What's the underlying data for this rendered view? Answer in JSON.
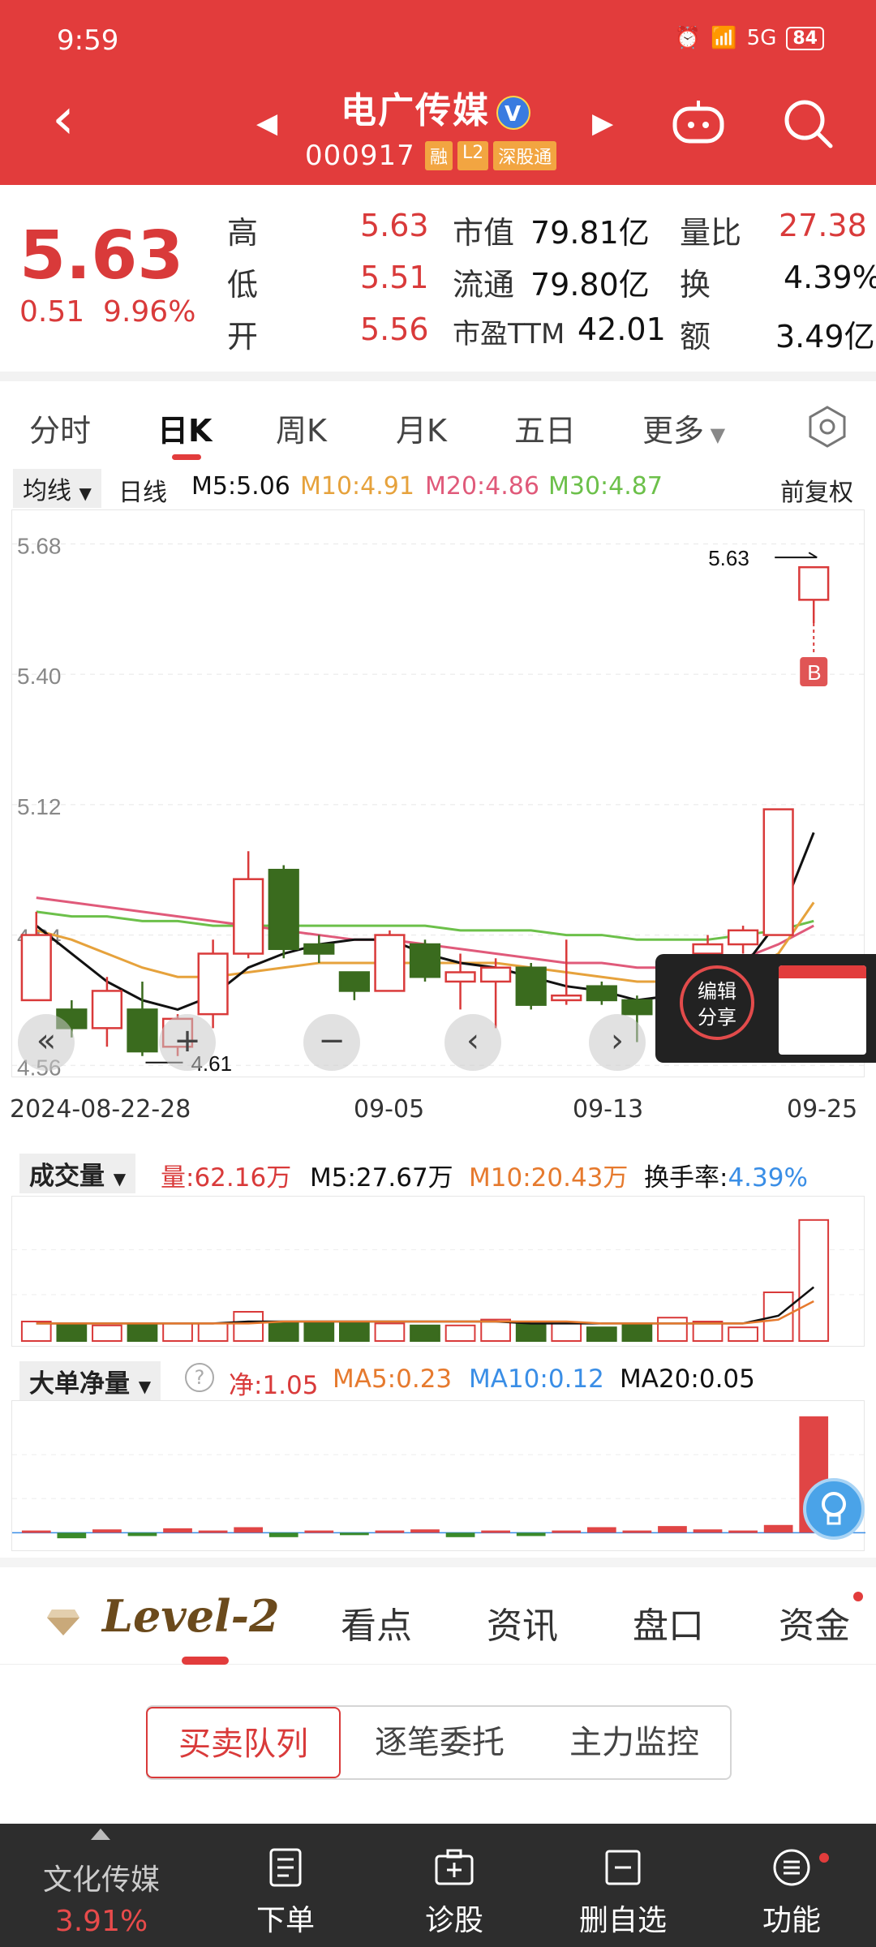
{
  "status": {
    "time": "9:59",
    "signal": "5G",
    "battery": "84"
  },
  "header": {
    "name": "电广传媒",
    "verify": "V",
    "code": "000917",
    "tags": [
      "融",
      "L2",
      "深股通"
    ]
  },
  "quote": {
    "price": "5.63",
    "change": "0.51",
    "change_pct": "9.96%",
    "rows": [
      {
        "l1": "高",
        "v1": "5.63",
        "l2": "市值",
        "v2": "79.81亿",
        "l3": "量比",
        "v3": "27.38"
      },
      {
        "l1": "低",
        "v1": "5.51",
        "l2": "流通",
        "v2": "79.80亿",
        "l3": "换",
        "v3": "4.39%"
      },
      {
        "l1": "开",
        "v1": "5.56",
        "l2": "市盈TTM",
        "v2": "42.01",
        "l3": "额",
        "v3": "3.49亿"
      }
    ]
  },
  "period_tabs": [
    "分时",
    "日K",
    "周K",
    "月K",
    "五日",
    "更多"
  ],
  "ma": {
    "dropdown": "均线",
    "period": "日线",
    "m5": "M5:5.06",
    "m10": "M10:4.91",
    "m20": "M20:4.86",
    "m30": "M30:4.87",
    "adjust": "前复权",
    "colors": {
      "m5": "#111111",
      "m10": "#e6a23c",
      "m20": "#e05a7a",
      "m30": "#6cc04a"
    }
  },
  "chart_data": [
    {
      "type": "candlestick",
      "y_ticks": [
        "5.68",
        "5.40",
        "5.12",
        "4.84",
        "4.56"
      ],
      "ylim": [
        4.55,
        5.7
      ],
      "high_label": "5.63",
      "low_label": "4.61",
      "x_ticks": [
        "2024-08-22",
        "-28",
        "09-05",
        "09-13",
        "09-25"
      ],
      "candles": [
        {
          "o": 4.7,
          "c": 4.84,
          "h": 4.89,
          "l": 4.7
        },
        {
          "o": 4.68,
          "c": 4.64,
          "h": 4.7,
          "l": 4.62
        },
        {
          "o": 4.64,
          "c": 4.72,
          "h": 4.75,
          "l": 4.6
        },
        {
          "o": 4.68,
          "c": 4.59,
          "h": 4.74,
          "l": 4.58
        },
        {
          "o": 4.6,
          "c": 4.66,
          "h": 4.67,
          "l": 4.58
        },
        {
          "o": 4.67,
          "c": 4.8,
          "h": 4.83,
          "l": 4.64
        },
        {
          "o": 4.8,
          "c": 4.96,
          "h": 5.02,
          "l": 4.79
        },
        {
          "o": 4.98,
          "c": 4.81,
          "h": 4.99,
          "l": 4.79
        },
        {
          "o": 4.82,
          "c": 4.8,
          "h": 4.84,
          "l": 4.78
        },
        {
          "o": 4.76,
          "c": 4.72,
          "h": 4.76,
          "l": 4.7
        },
        {
          "o": 4.72,
          "c": 4.84,
          "h": 4.85,
          "l": 4.72
        },
        {
          "o": 4.82,
          "c": 4.75,
          "h": 4.83,
          "l": 4.74
        },
        {
          "o": 4.74,
          "c": 4.76,
          "h": 4.8,
          "l": 4.68
        },
        {
          "o": 4.74,
          "c": 4.77,
          "h": 4.79,
          "l": 4.64
        },
        {
          "o": 4.77,
          "c": 4.69,
          "h": 4.78,
          "l": 4.68
        },
        {
          "o": 4.7,
          "c": 4.71,
          "h": 4.83,
          "l": 4.69
        },
        {
          "o": 4.73,
          "c": 4.7,
          "h": 4.74,
          "l": 4.69
        },
        {
          "o": 4.7,
          "c": 4.67,
          "h": 4.71,
          "l": 4.61
        },
        {
          "o": 4.72,
          "c": 4.77,
          "h": 4.78,
          "l": 4.7
        },
        {
          "o": 4.8,
          "c": 4.82,
          "h": 4.84,
          "l": 4.79
        },
        {
          "o": 4.82,
          "c": 4.85,
          "h": 4.86,
          "l": 4.8
        },
        {
          "o": 4.84,
          "c": 5.11,
          "h": 5.11,
          "l": 4.84
        },
        {
          "o": 5.56,
          "c": 5.63,
          "h": 5.63,
          "l": 5.51
        }
      ],
      "ma5": [
        4.86,
        4.8,
        4.74,
        4.7,
        4.68,
        4.71,
        4.77,
        4.8,
        4.82,
        4.83,
        4.83,
        4.8,
        4.78,
        4.77,
        4.75,
        4.73,
        4.72,
        4.7,
        4.71,
        4.74,
        4.77,
        4.87,
        5.06
      ],
      "ma10": [
        4.85,
        4.83,
        4.8,
        4.77,
        4.75,
        4.75,
        4.76,
        4.77,
        4.78,
        4.78,
        4.78,
        4.78,
        4.78,
        4.78,
        4.77,
        4.76,
        4.75,
        4.74,
        4.74,
        4.74,
        4.76,
        4.8,
        4.91
      ],
      "ma20": [
        4.92,
        4.91,
        4.9,
        4.89,
        4.88,
        4.87,
        4.86,
        4.85,
        4.84,
        4.83,
        4.83,
        4.82,
        4.81,
        4.8,
        4.79,
        4.78,
        4.78,
        4.77,
        4.77,
        4.78,
        4.79,
        4.82,
        4.86
      ],
      "ma30": [
        4.89,
        4.88,
        4.88,
        4.87,
        4.87,
        4.86,
        4.86,
        4.86,
        4.86,
        4.86,
        4.86,
        4.86,
        4.85,
        4.85,
        4.85,
        4.84,
        4.84,
        4.83,
        4.83,
        4.83,
        4.84,
        4.85,
        4.87
      ]
    },
    {
      "type": "bar",
      "title": "成交量",
      "volumes": [
        10,
        9,
        8,
        9,
        9,
        9,
        15,
        10,
        10,
        10,
        9,
        8,
        8,
        11,
        9,
        9,
        7,
        9,
        12,
        10,
        7,
        25,
        62.16
      ],
      "ma5_line": [
        9,
        9,
        9,
        9,
        9,
        9,
        10,
        10,
        10,
        10,
        10,
        10,
        10,
        10,
        9,
        9,
        9,
        9,
        9,
        9,
        9,
        13,
        27.67
      ],
      "ma10_line": [
        9,
        9,
        9,
        9,
        9,
        9,
        9,
        10,
        10,
        10,
        10,
        10,
        10,
        10,
        10,
        10,
        9,
        9,
        9,
        9,
        9,
        11,
        20.43
      ],
      "ylim": [
        0,
        70
      ]
    },
    {
      "type": "bar",
      "title": "大单净量",
      "values": [
        0.02,
        -0.05,
        0.03,
        -0.03,
        0.04,
        0.02,
        0.05,
        -0.04,
        0.02,
        -0.02,
        0.02,
        0.03,
        -0.04,
        0.02,
        -0.03,
        0.02,
        0.05,
        0.02,
        0.06,
        0.03,
        0.02,
        0.07,
        1.05
      ],
      "ylim": [
        -0.1,
        1.1
      ]
    }
  ],
  "volume": {
    "dropdown": "成交量",
    "amount": "量:62.16万",
    "m5": "M5:27.67万",
    "m10": "M10:20.43万",
    "turnover_label": "换手率:",
    "turnover": "4.39%"
  },
  "bigorder": {
    "dropdown": "大单净量",
    "net": "净:1.05",
    "ma5": "MA5:0.23",
    "ma10": "MA10:0.12",
    "ma20": "MA20:0.05"
  },
  "share": {
    "label1": "编辑",
    "label2": "分享"
  },
  "level2": {
    "logo": "Level-2",
    "tabs": [
      "看点",
      "资讯",
      "盘口",
      "资金"
    ]
  },
  "segments": [
    "买卖队列",
    "逐笔委托",
    "主力监控"
  ],
  "bottom_nav": {
    "sector_name": "文化传媒",
    "sector_pct": "3.91%",
    "items": [
      "下单",
      "诊股",
      "删自选",
      "功能"
    ]
  }
}
